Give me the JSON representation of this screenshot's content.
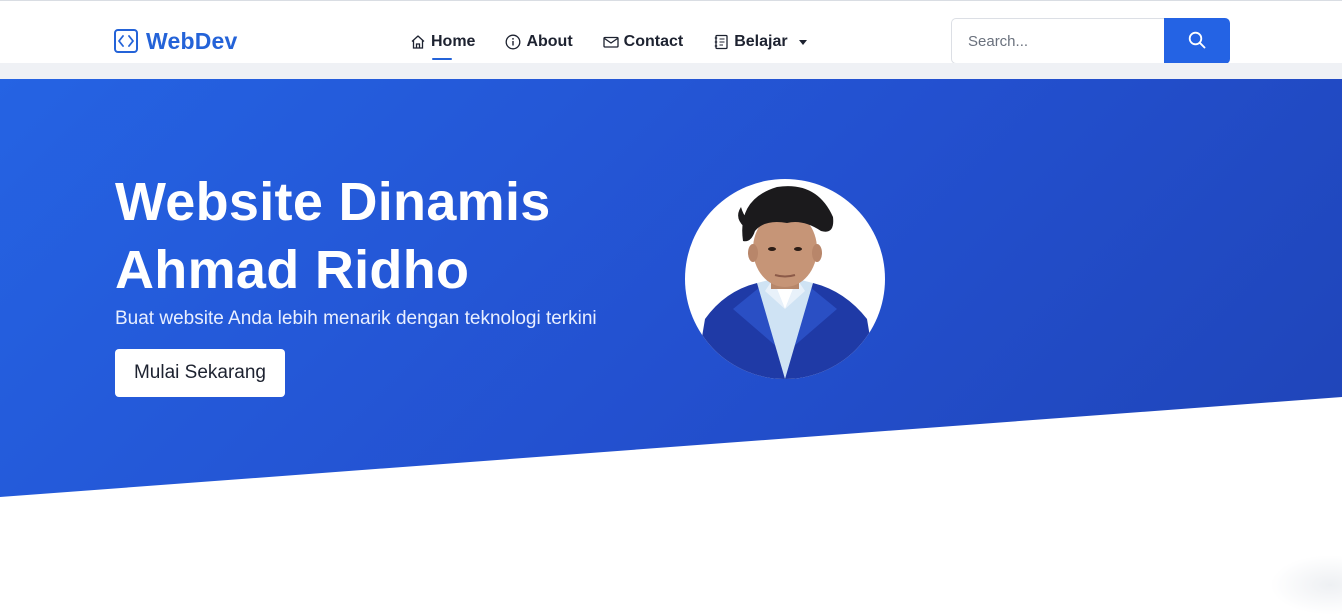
{
  "brand": {
    "name": "WebDev",
    "icon": "code-brackets-icon",
    "color": "#2463d8"
  },
  "nav": {
    "items": [
      {
        "label": "Home",
        "icon": "home-icon",
        "active": true
      },
      {
        "label": "About",
        "icon": "info-circle-icon",
        "active": false
      },
      {
        "label": "Contact",
        "icon": "envelope-icon",
        "active": false
      },
      {
        "label": "Belajar",
        "icon": "journal-icon",
        "active": false,
        "dropdown": true
      }
    ]
  },
  "search": {
    "placeholder": "Search...",
    "value": "",
    "button_icon": "search-icon"
  },
  "hero": {
    "title_line1": "Website Dinamis",
    "title_line2": "Ahmad Ridho",
    "subtitle": "Buat website Anda lebih menarik dengan teknologi terkini",
    "cta_label": "Mulai Sekarang",
    "colors": {
      "start": "#2563e3",
      "end": "#1f44b7"
    }
  }
}
